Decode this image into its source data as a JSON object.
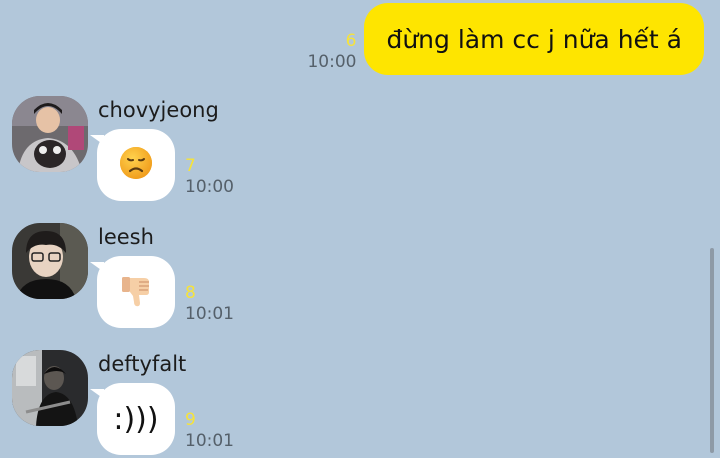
{
  "outgoing": {
    "text": "đừng làm cc j nữa hết á",
    "unread": "6",
    "time": "10:00"
  },
  "messages": [
    {
      "sender": "chovyjeong",
      "content_icon": "sad-face-emoji",
      "unread": "7",
      "time": "10:00"
    },
    {
      "sender": "leesh",
      "content_icon": "thumbs-down-emoji",
      "unread": "8",
      "time": "10:01"
    },
    {
      "sender": "deftyfalt",
      "text": ":)))",
      "unread": "9",
      "time": "10:01"
    }
  ],
  "colors": {
    "background": "#b2c7da",
    "outgoing_bubble": "#fee500",
    "incoming_bubble": "#ffffff",
    "unread_count": "#f6e33a"
  }
}
